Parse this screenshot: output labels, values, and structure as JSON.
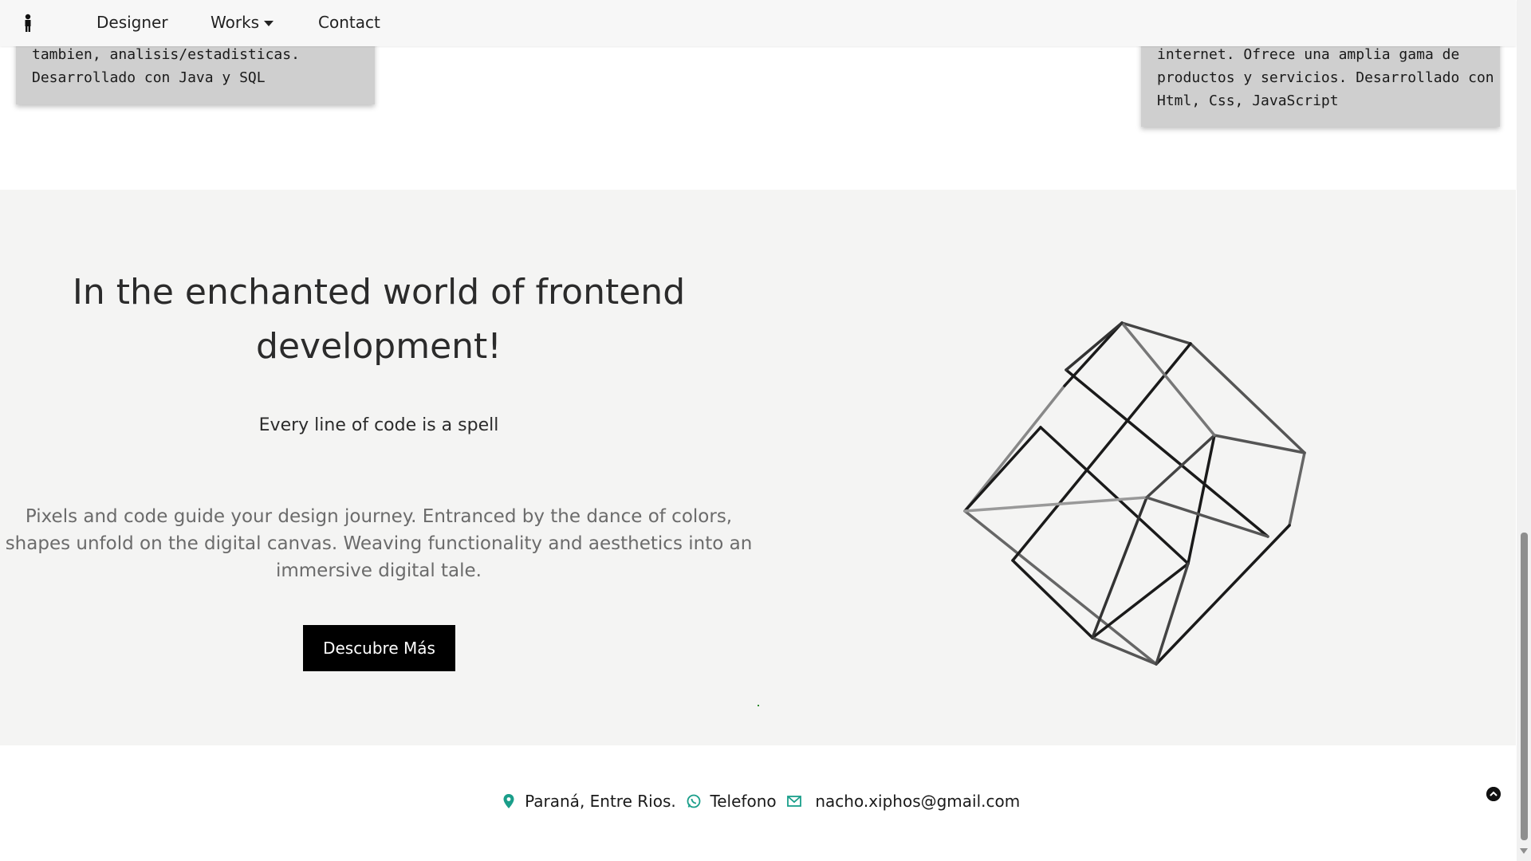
{
  "nav": {
    "logo_icon": "person-icon",
    "items": [
      {
        "label": "Designer"
      },
      {
        "label": "Works"
      },
      {
        "label": "Contact"
      }
    ]
  },
  "cards": {
    "left": {
      "lines": [
        "tambien, analisis/estadisticas.",
        "Desarrollado con Java y SQL"
      ]
    },
    "right": {
      "lines": [
        "internet. Ofrece una amplia gama de",
        "productos y servicios. Desarrollado con",
        "Html, Css, JavaScript"
      ]
    }
  },
  "hero": {
    "title_line1": "In the enchanted world of frontend",
    "title_line2": "development!",
    "subtitle": "Every line of code is a spell",
    "desc_line1": "Pixels and code guide your design journey. Entranced by the dance of colors,",
    "desc_line2": "shapes unfold on the digital canvas. Weaving functionality and aesthetics into an",
    "desc_line3": "immersive digital tale.",
    "button_label": "Descubre Más"
  },
  "footer": {
    "location": "Paraná, Entre Rios.",
    "phone_label": "Telefono",
    "email": "nacho.xiphos@gmail.com",
    "accent_color": "#1a9e8a"
  }
}
